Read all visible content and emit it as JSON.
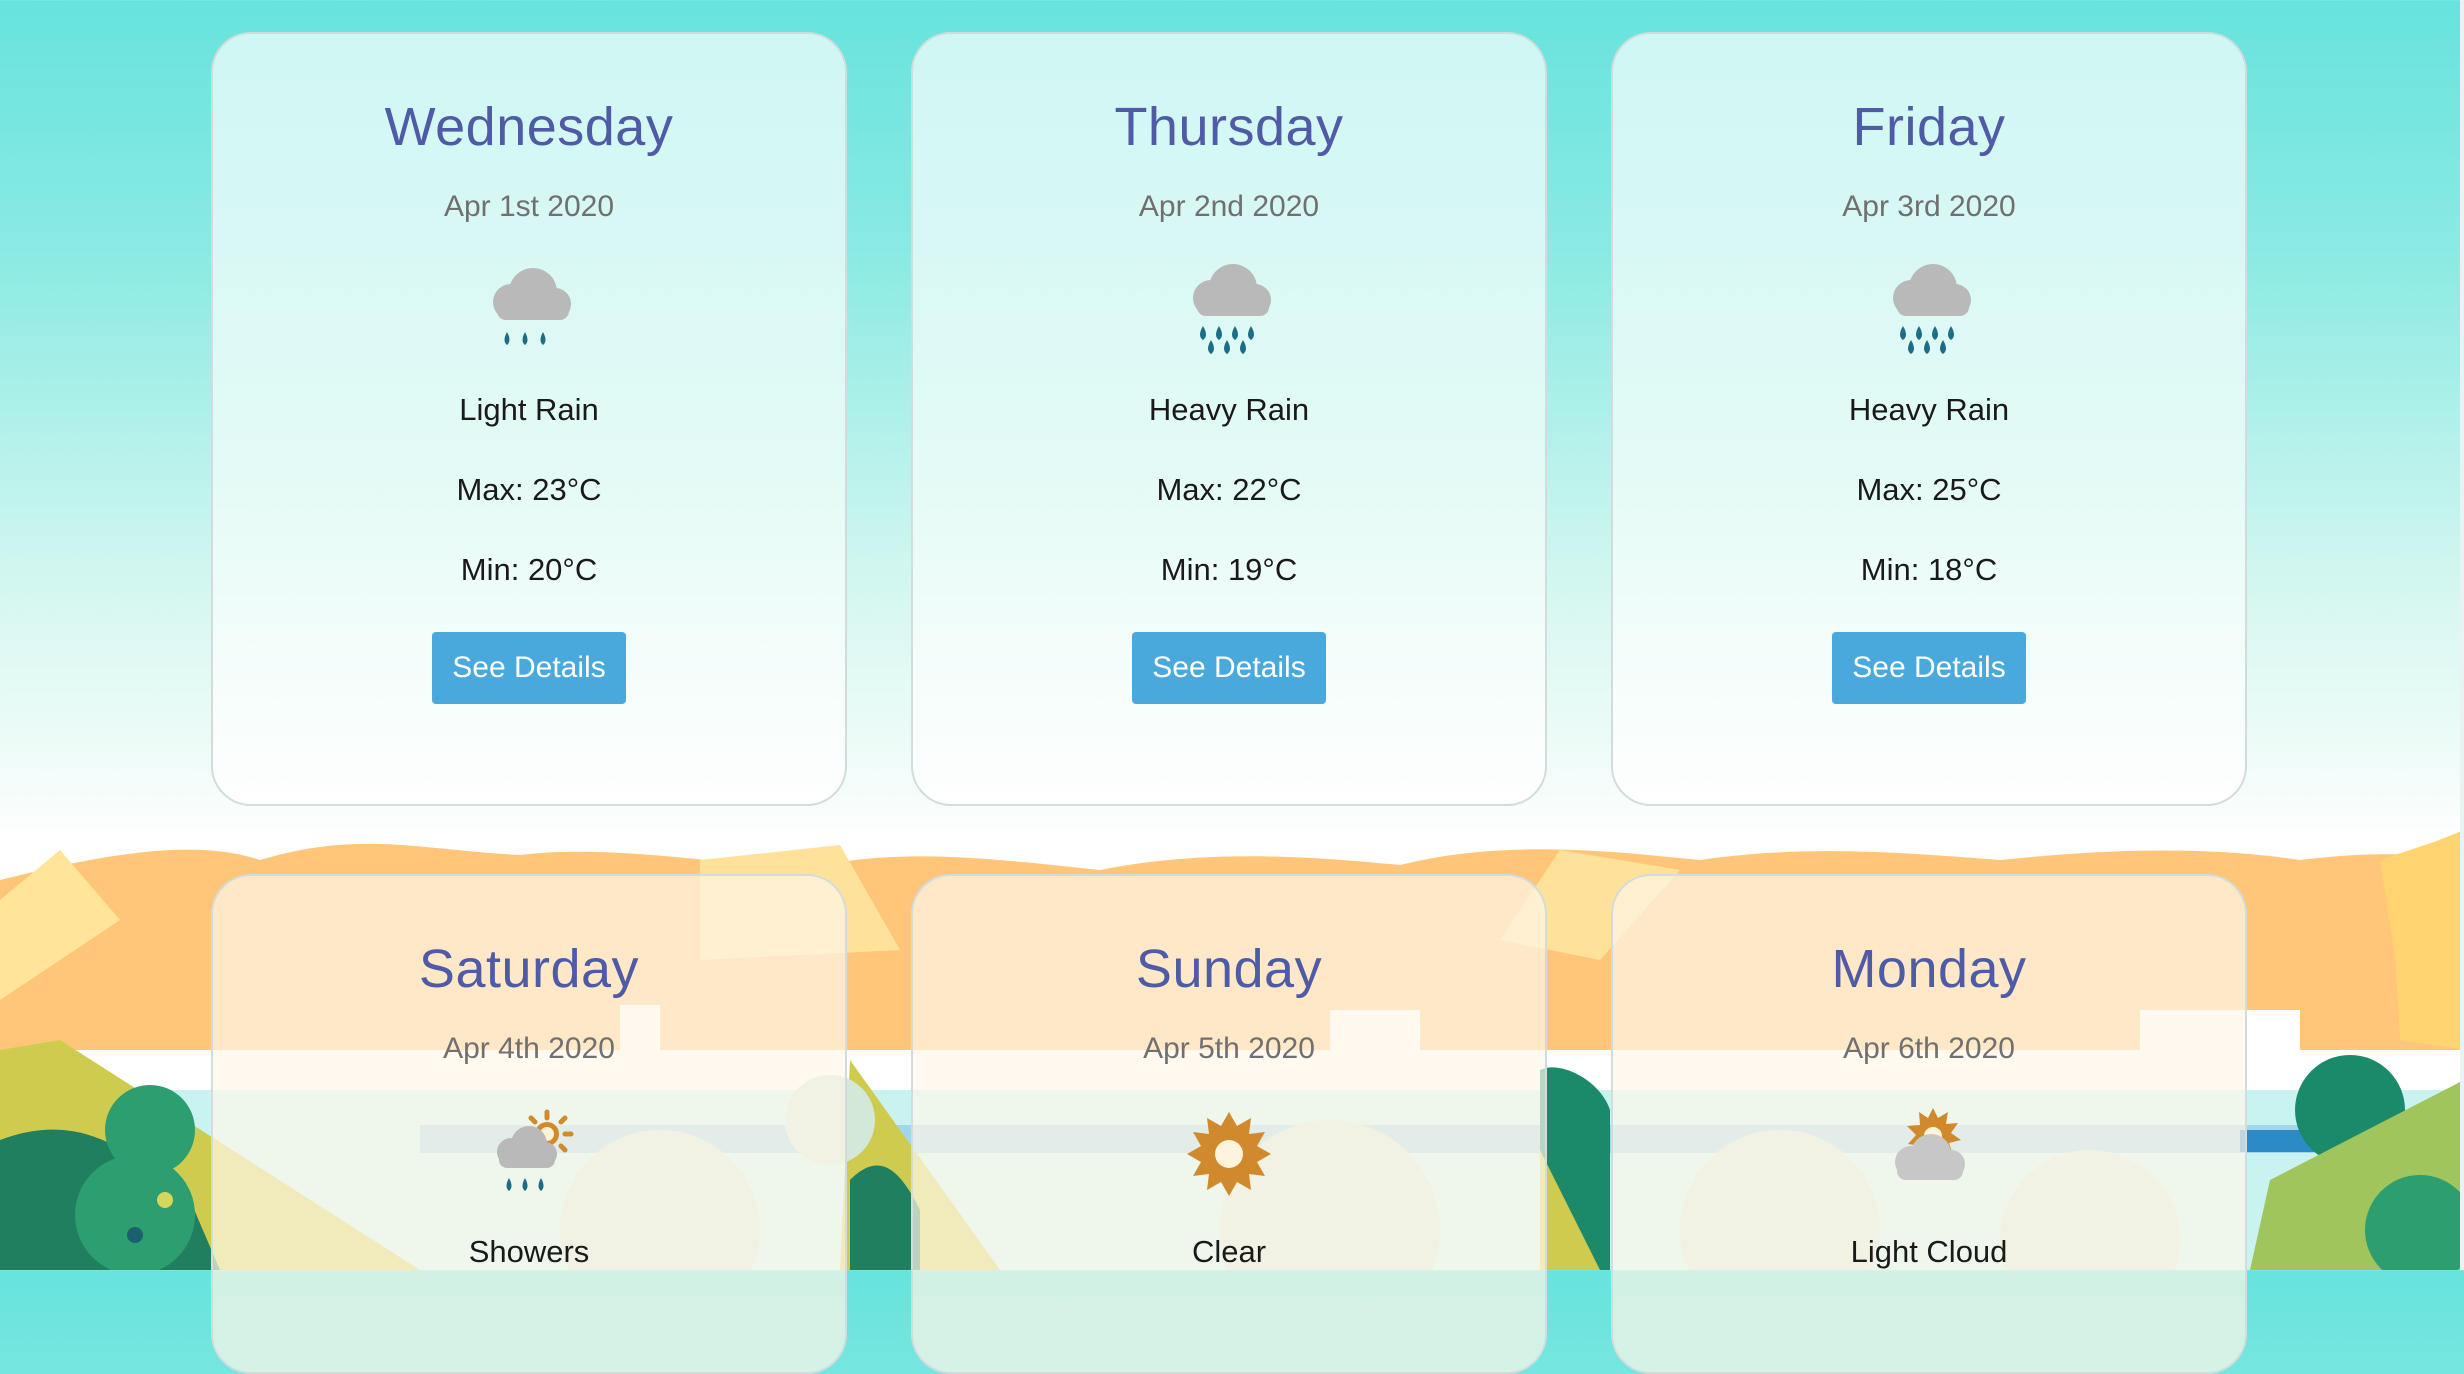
{
  "forecast": [
    {
      "day": "Wednesday",
      "date": "Apr 1st 2020",
      "condition": "Light Rain",
      "max": "Max: 23°C",
      "min": "Min: 20°C",
      "button": "See Details",
      "icon": "light-rain-icon"
    },
    {
      "day": "Thursday",
      "date": "Apr 2nd 2020",
      "condition": "Heavy Rain",
      "max": "Max: 22°C",
      "min": "Min: 19°C",
      "button": "See Details",
      "icon": "heavy-rain-icon"
    },
    {
      "day": "Friday",
      "date": "Apr 3rd 2020",
      "condition": "Heavy Rain",
      "max": "Max: 25°C",
      "min": "Min: 18°C",
      "button": "See Details",
      "icon": "heavy-rain-icon"
    },
    {
      "day": "Saturday",
      "date": "Apr 4th 2020",
      "condition": "Showers",
      "icon": "showers-icon"
    },
    {
      "day": "Sunday",
      "date": "Apr 5th 2020",
      "condition": "Clear",
      "icon": "clear-sun-icon"
    },
    {
      "day": "Monday",
      "date": "Apr 6th 2020",
      "condition": "Light Cloud",
      "icon": "light-cloud-icon"
    }
  ],
  "colors": {
    "day_title": "#4f5ba6",
    "button": "#4aa9dc",
    "sky_top": "#67e3dd"
  }
}
